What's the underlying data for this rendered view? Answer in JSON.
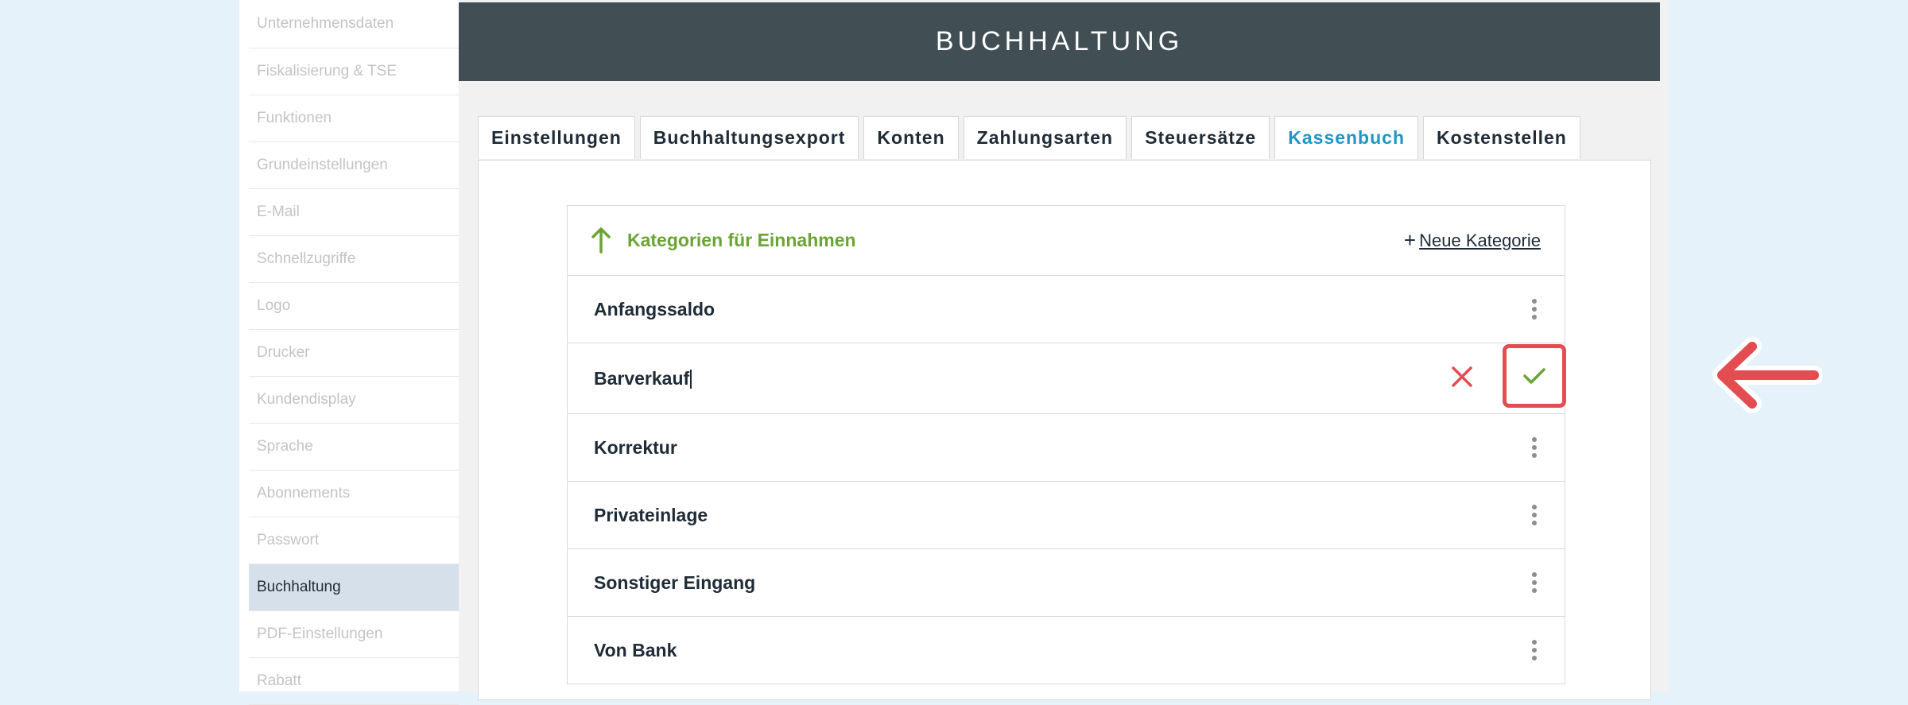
{
  "sidebar": {
    "items": [
      {
        "label": "Unternehmensdaten"
      },
      {
        "label": "Fiskalisierung & TSE"
      },
      {
        "label": "Funktionen"
      },
      {
        "label": "Grundeinstellungen"
      },
      {
        "label": "E-Mail"
      },
      {
        "label": "Schnellzugriffe"
      },
      {
        "label": "Logo"
      },
      {
        "label": "Drucker"
      },
      {
        "label": "Kundendisplay"
      },
      {
        "label": "Sprache"
      },
      {
        "label": "Abonnements"
      },
      {
        "label": "Passwort"
      },
      {
        "label": "Buchhaltung",
        "active": true
      },
      {
        "label": "PDF-Einstellungen"
      },
      {
        "label": "Rabatt"
      }
    ]
  },
  "header": {
    "title": "BUCHHALTUNG"
  },
  "tabs": [
    {
      "label": "Einstellungen"
    },
    {
      "label": "Buchhaltungsexport"
    },
    {
      "label": "Konten"
    },
    {
      "label": "Zahlungsarten"
    },
    {
      "label": "Steuersätze"
    },
    {
      "label": "Kassenbuch",
      "active": true
    },
    {
      "label": "Kostenstellen"
    }
  ],
  "categories": {
    "title": "Kategorien für Einnahmen",
    "new_plus": "+",
    "new_label": "Neue Kategorie",
    "rows": [
      {
        "label": "Anfangssaldo"
      },
      {
        "label": "Barverkauf",
        "editing": true
      },
      {
        "label": "Korrektur"
      },
      {
        "label": "Privateinlage"
      },
      {
        "label": "Sonstiger Eingang"
      },
      {
        "label": "Von Bank"
      }
    ]
  },
  "colors": {
    "header_bg": "#414f55",
    "accent_green": "#6aa435",
    "accent_blue": "#1f97c5",
    "alert_red": "#e34d52",
    "sidebar_active_bg": "#d5e0ea"
  },
  "icons": {
    "category_direction": "arrow-up-icon",
    "row_menu": "kebab-menu-icon",
    "cancel": "close-icon",
    "confirm": "check-icon",
    "callout": "arrow-left-icon"
  }
}
